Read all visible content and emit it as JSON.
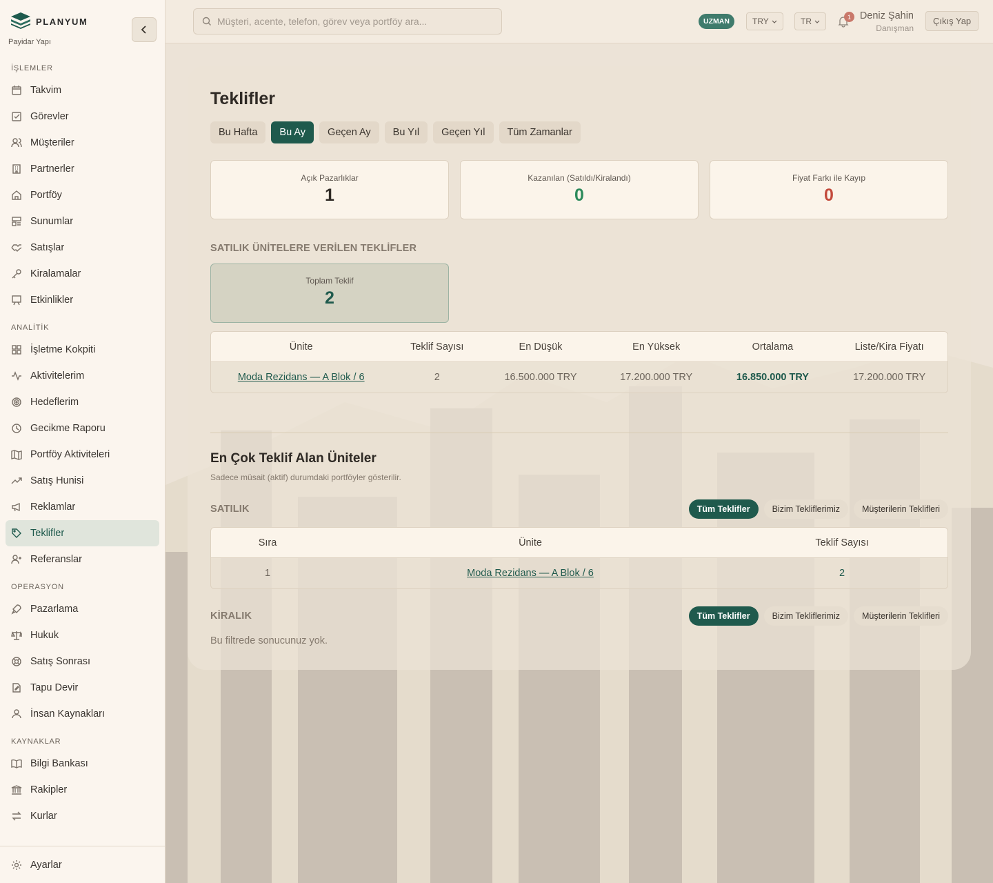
{
  "app": {
    "brand": "PLANYUM",
    "brand_sub": "Payidar Yapı"
  },
  "sidebar": {
    "sections": [
      {
        "title": "İŞLEMLER",
        "items": [
          "Takvim",
          "Görevler",
          "Müşteriler",
          "Partnerler",
          "Portföy",
          "Sunumlar",
          "Satışlar",
          "Kiralamalar",
          "Etkinlikler"
        ]
      },
      {
        "title": "ANALİTİK",
        "items": [
          "İşletme Kokpiti",
          "Aktivitelerim",
          "Hedeflerim",
          "Gecikme Raporu",
          "Portföy Aktiviteleri",
          "Satış Hunisi",
          "Reklamlar",
          "Teklifler",
          "Referanslar"
        ]
      },
      {
        "title": "OPERASYON",
        "items": [
          "Pazarlama",
          "Hukuk",
          "Satış Sonrası",
          "Tapu Devir",
          "İnsan Kaynakları"
        ]
      },
      {
        "title": "KAYNAKLAR",
        "items": [
          "Bilgi Bankası",
          "Rakipler",
          "Kurlar"
        ]
      }
    ],
    "active_item": "Teklifler",
    "footer_item": "Ayarlar"
  },
  "topbar": {
    "search_placeholder": "Müşteri, acente, telefon, görev veya portföy ara...",
    "role_badge": "UZMAN",
    "currency": "TRY",
    "language": "TR",
    "notification_count": "1",
    "user_name": "Deniz Şahin",
    "user_role": "Danışman",
    "logout_label": "Çıkış Yap"
  },
  "page": {
    "title": "Teklifler",
    "tabs": [
      "Bu Hafta",
      "Bu Ay",
      "Geçen Ay",
      "Bu Yıl",
      "Geçen Yıl",
      "Tüm Zamanlar"
    ],
    "active_tab": "Bu Ay",
    "stats": [
      {
        "label": "Açık Pazarlıklar",
        "value": "1"
      },
      {
        "label": "Kazanılan (Satıldı/Kiralandı)",
        "value": "0"
      },
      {
        "label": "Fiyat Farkı ile Kayıp",
        "value": "0"
      }
    ],
    "sale_offers": {
      "title": "SATILIK ÜNİTELERE VERİLEN TEKLİFLER",
      "total_label": "Toplam Teklif",
      "total_value": "2",
      "columns": [
        "Ünite",
        "Teklif Sayısı",
        "En Düşük",
        "En Yüksek",
        "Ortalama",
        "Liste/Kira Fiyatı"
      ],
      "rows": [
        {
          "unit": "Moda Rezidans — A Blok / 6",
          "count": "2",
          "min": "16.500.000 TRY",
          "max": "17.200.000 TRY",
          "avg": "16.850.000 TRY",
          "list": "17.200.000 TRY"
        }
      ]
    },
    "top_units": {
      "title": "En Çok Teklif Alan Üniteler",
      "subtitle": "Sadece müsait (aktif) durumdaki portföyler gösterilir.",
      "filters": [
        "Tüm Teklifler",
        "Bizim Tekliflerimiz",
        "Müşterilerin Teklifleri"
      ],
      "sale": {
        "title": "SATILIK",
        "columns": [
          "Sıra",
          "Ünite",
          "Teklif Sayısı"
        ],
        "rows": [
          {
            "rank": "1",
            "unit": "Moda Rezidans — A Blok / 6",
            "count": "2"
          }
        ]
      },
      "rent": {
        "title": "KİRALIK",
        "empty_text": "Bu filtrede sonucunuz yok."
      }
    }
  },
  "colors": {
    "accent": "#1f5a4d",
    "success": "#2c8a5b",
    "danger": "#c34a3c",
    "sidebar_bg": "#fbf5ee",
    "page_bg": "#ece3d7"
  }
}
